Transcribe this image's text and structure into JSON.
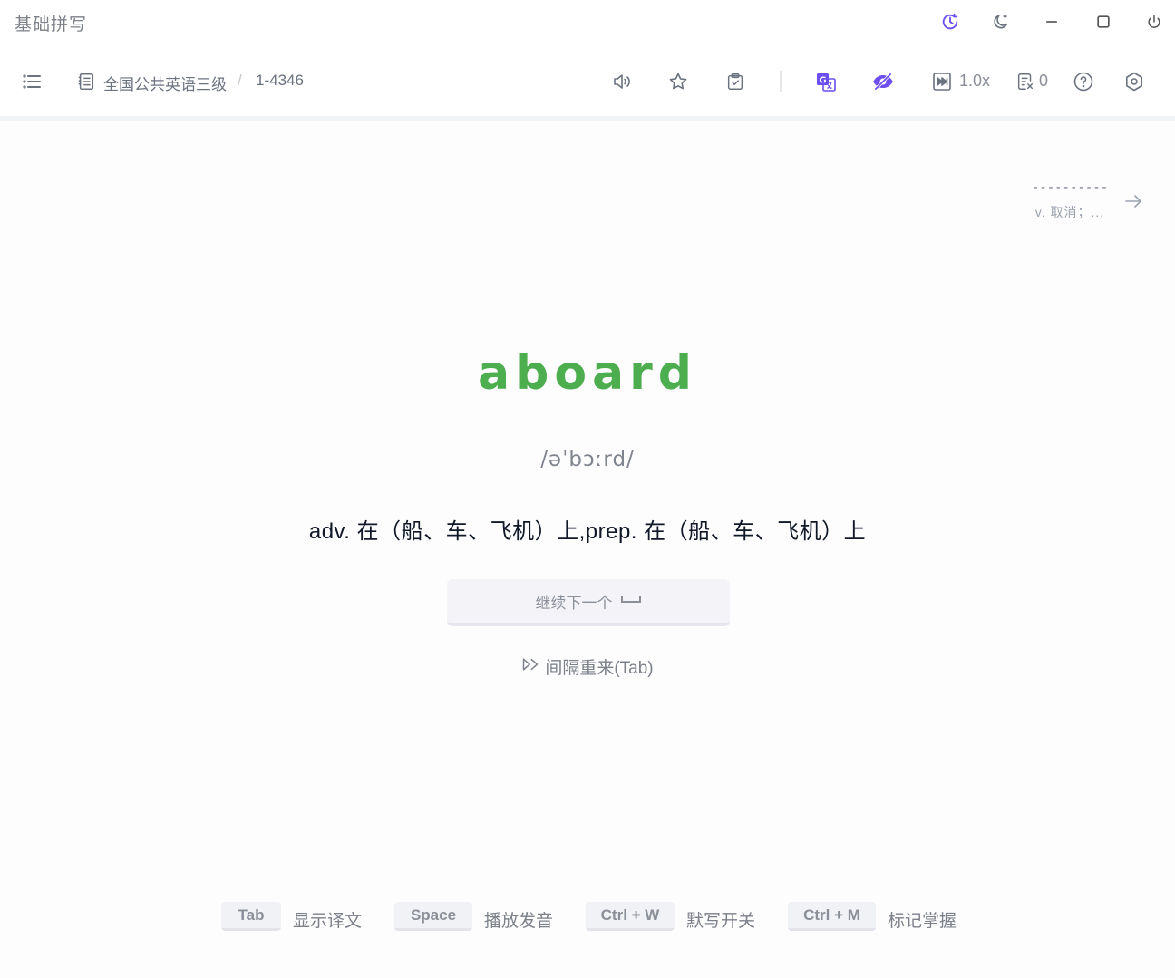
{
  "app": {
    "title": "基础拼写"
  },
  "toolbar": {
    "dict_name": "全国公共英语三级",
    "separator": "/",
    "chapter": "1-4346",
    "speed": "1.0x",
    "error_count": "0"
  },
  "next_word": {
    "dashes": "----------",
    "translation": "v. 取消；..."
  },
  "current_word": {
    "word": "aboard",
    "phonetic": "/əˈbɔːrd/",
    "translation": "adv. 在（船、车、飞机）上,prep. 在（船、车、飞机）上"
  },
  "actions": {
    "continue_label": "继续下一个",
    "retry_label": "间隔重来(Tab)"
  },
  "shortcuts": [
    {
      "key": "Tab",
      "label": "显示译文"
    },
    {
      "key": "Space",
      "label": "播放发音"
    },
    {
      "key": "Ctrl + W",
      "label": "默写开关"
    },
    {
      "key": "Ctrl + M",
      "label": "标记掌握"
    }
  ],
  "colors": {
    "accent": "#6d4ef0",
    "word_correct": "#4cae4f"
  },
  "icons": {
    "titlebar": [
      "history-icon",
      "dark-mode-icon",
      "minimize-icon",
      "maximize-icon",
      "power-icon"
    ],
    "toolbar": [
      "menu-list-icon",
      "dictionary-icon",
      "pronunciation-icon",
      "star-icon",
      "clipboard-check-icon",
      "translate-icon",
      "eye-hidden-icon",
      "play-speed-icon",
      "error-book-icon",
      "help-icon",
      "settings-icon"
    ]
  }
}
